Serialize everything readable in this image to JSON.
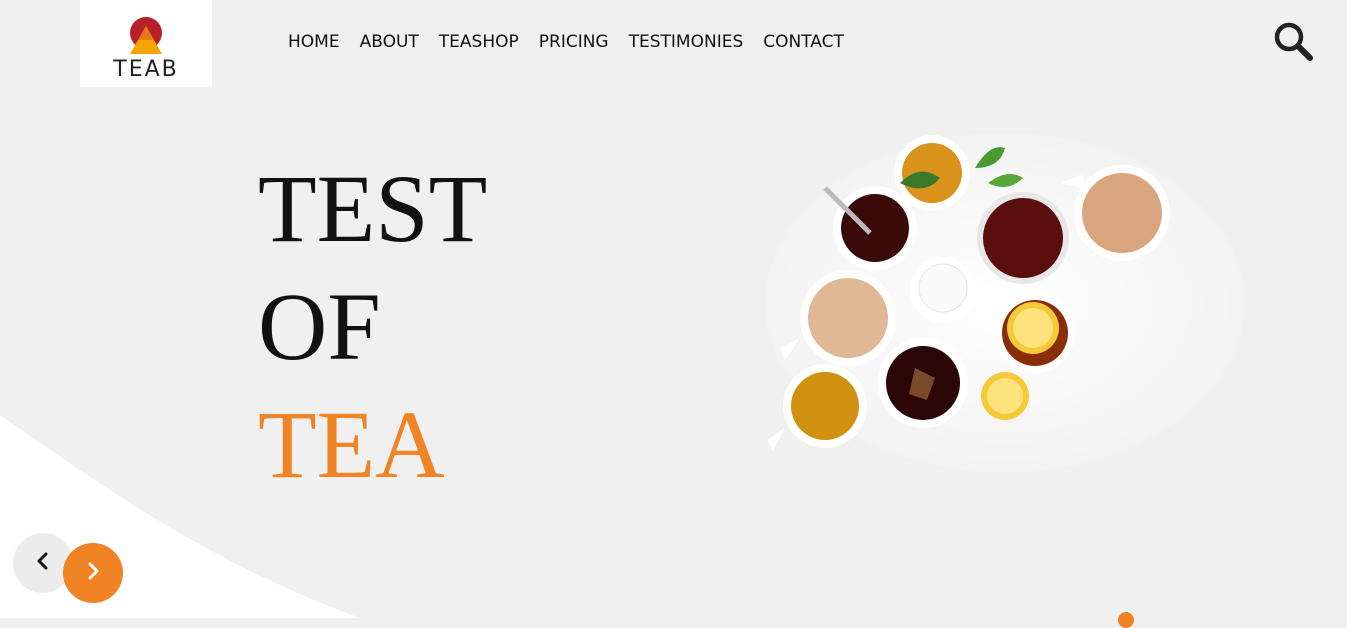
{
  "brand": {
    "logo_text": "TEAB",
    "accent_color": "#f08424",
    "logo_colors": [
      "#b8202a",
      "#f5a500"
    ]
  },
  "nav": {
    "items": [
      {
        "label": "HOME"
      },
      {
        "label": "ABOUT"
      },
      {
        "label": "TEASHOP"
      },
      {
        "label": "PRICING"
      },
      {
        "label": "TESTIMONIES"
      },
      {
        "label": "CONTACT"
      }
    ],
    "search_icon": "search-icon"
  },
  "hero": {
    "line1": "TEST",
    "line2": "OF",
    "line3": "TEA",
    "image_icon": "tea-cups-image"
  },
  "slider": {
    "prev_icon": "chevron-left-icon",
    "next_icon": "chevron-right-icon"
  }
}
